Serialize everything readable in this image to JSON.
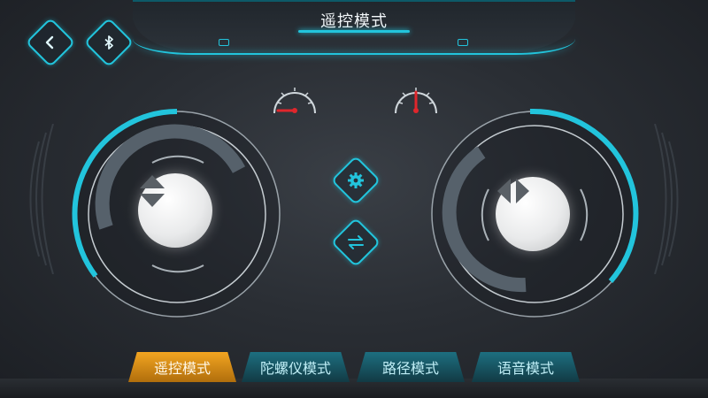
{
  "header": {
    "title": "遥控模式"
  },
  "top_left": {
    "back_icon": "chevron-left-icon",
    "bluetooth_icon": "bluetooth-icon"
  },
  "center_controls": {
    "settings_icon": "gear-icon",
    "swap_icon": "swap-arrows-icon"
  },
  "joysticks": {
    "left": {
      "icon": "up-down-arrows-icon"
    },
    "right": {
      "icon": "left-right-arrows-icon"
    }
  },
  "gauges": {
    "left_icon": "speed-gauge-icon",
    "right_icon": "speed-gauge-icon"
  },
  "tabs": [
    {
      "label": "遥控模式",
      "active": true
    },
    {
      "label": "陀螺仪模式",
      "active": false
    },
    {
      "label": "路径模式",
      "active": false
    },
    {
      "label": "语音模式",
      "active": false
    }
  ],
  "colors": {
    "accent": "#22c4dc",
    "active_tab": "#f3a521",
    "needle": "#e0262c"
  }
}
